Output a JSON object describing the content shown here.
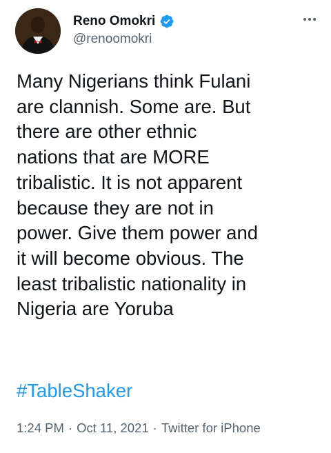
{
  "author": {
    "display_name": "Reno Omokri",
    "handle": "@renoomokri",
    "verified": true,
    "avatar_icon": "profile-photo"
  },
  "menu": {
    "icon": "more-horizontal-icon"
  },
  "tweet": {
    "text": "Many Nigerians think Fulani\nare clannish. Some are. But\nthere are other ethnic\nnations that are MORE\ntribalistic. It is not apparent\nbecause they are not in\npower. Give them power and\nit will become obvious. The\nleast tribalistic nationality in\nNigeria are Yoruba",
    "hashtag": "#TableShaker"
  },
  "meta": {
    "time": "1:24 PM",
    "separator": "·",
    "date": "Oct 11, 2021",
    "source": "Twitter for iPhone"
  },
  "colors": {
    "text": "#0f1419",
    "secondary": "#536471",
    "link": "#1d9bf0",
    "verified_badge": "#1d9bf0"
  }
}
